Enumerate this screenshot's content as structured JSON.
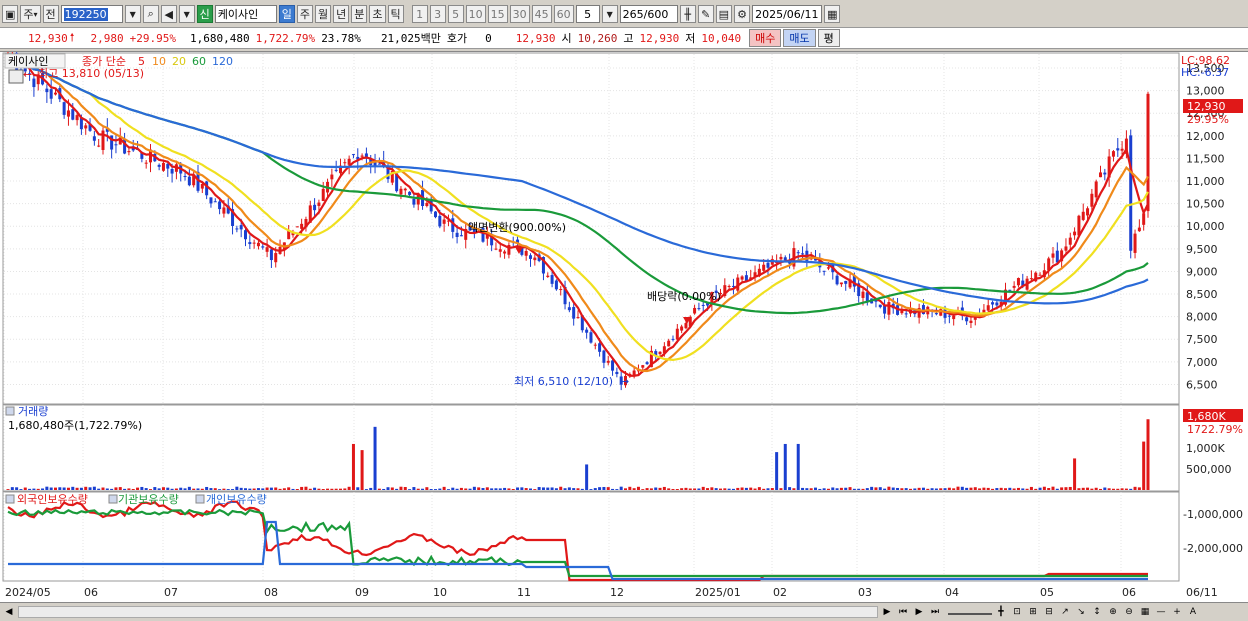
{
  "toolbar": {
    "period_label": "주",
    "prev_label": "전",
    "code": "192250",
    "shin_label": "신",
    "stock_name": "케이사인",
    "day_tab": "일",
    "week_tab": "주",
    "month_tab": "월",
    "year_tab": "년",
    "minute_tab": "분",
    "second_tab": "초",
    "tick_tab": "틱",
    "intervals": [
      "1",
      "3",
      "5",
      "10",
      "15",
      "30",
      "45",
      "60"
    ],
    "interval_value": "5",
    "count_value": "265",
    "count_total": "/600",
    "date_value": "2025/06/11"
  },
  "quote": {
    "price": "12,930",
    "change": "2,980",
    "change_pct": "+29.95%",
    "volume": "1,680,480",
    "volume_pct": "1,722.79%",
    "turnover": "23.78%",
    "amount": "21,025백만",
    "hoga_label": "호가",
    "hoga_value": "0",
    "bid_price": "12,930",
    "open_label": "시",
    "open": "10,260",
    "high_label": "고",
    "high": "12,930",
    "low_label": "저",
    "low": "10,040",
    "buy_label": "매수",
    "sell_label": "매도",
    "eval_label": "평"
  },
  "price_panel": {
    "stock_name": "케이사인",
    "ma_label": "종가 단순",
    "ma_periods": [
      "5",
      "10",
      "20",
      "60",
      "120"
    ],
    "ma_colors": [
      "#e01818",
      "#f08a1a",
      "#f0e020",
      "#1a9a3a",
      "#2a6ad8"
    ],
    "lc": "LC:98.62",
    "hc": "HC:-6.37",
    "high_marker": "최고 13,810 (05/13)",
    "low_marker": "최저 6,510 (12/10)",
    "event1": "액면변환(900.00%)",
    "event2": "배당락(0.00%)",
    "current_price": "12,930",
    "current_pct": "29.95%",
    "y_ticks": [
      "13,500",
      "13,000",
      "12,500",
      "12,000",
      "11,500",
      "11,000",
      "10,500",
      "10,000",
      "9,500",
      "9,000",
      "8,500",
      "8,000",
      "7,500",
      "7,000",
      "6,500"
    ]
  },
  "volume_panel": {
    "label": "거래량",
    "value": "1,680,480주(1,722.79%)",
    "current": "1,680K",
    "current_pct": "1722.79%",
    "y_ticks": [
      "1,000K",
      "500,000"
    ]
  },
  "holding_panel": {
    "foreign_label": "외국인보유수량",
    "inst_label": "기관보유수량",
    "indiv_label": "개인보유수량",
    "y_ticks": [
      "-1,000,000",
      "-2,000,000"
    ]
  },
  "x_ticks": [
    "2024/05",
    "06",
    "07",
    "08",
    "09",
    "10",
    "11",
    "12",
    "2025/01",
    "02",
    "03",
    "04",
    "05",
    "06",
    "06/11"
  ],
  "chart_data": {
    "type": "line",
    "description_axes": "price (KRW) vs date",
    "series": [
      {
        "name": "종가",
        "x": [
          "2024/05/13",
          "2024/06",
          "2024/07",
          "2024/08",
          "2024/09",
          "2024/10",
          "2024/11",
          "2024/12/10",
          "2025/01",
          "2025/02",
          "2025/03",
          "2025/04",
          "2025/05",
          "2025/06/11"
        ],
        "values": [
          13810,
          12000,
          11200,
          9300,
          11700,
          10000,
          9400,
          6510,
          8400,
          9400,
          8200,
          8000,
          9400,
          12930
        ]
      }
    ],
    "ylim": [
      6500,
      13700
    ]
  }
}
